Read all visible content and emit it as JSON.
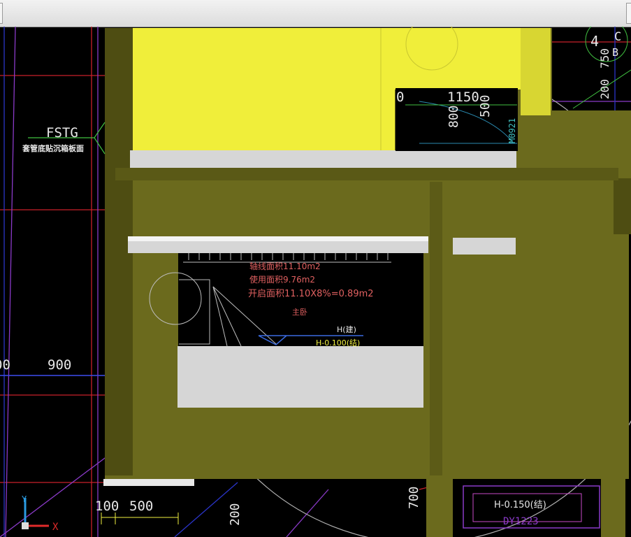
{
  "colors": {
    "background": "#000000",
    "wall": "#6b6a1d",
    "wall_dark": "#4e4d12",
    "yellow_block": "#f0ee3a",
    "slab_gray": "#d6d6d6",
    "grid_red": "#c8202a",
    "grid_blue": "#2a34c8",
    "grid_purple": "#8a3ac8",
    "circle_gray": "#b0b0b0",
    "text_white": "#e8e8e8",
    "text_red": "#e06060",
    "text_yellow": "#f0f040",
    "text_cyan": "#40c0c0"
  },
  "titlebar": {
    "button_icon": "window-button-icon"
  },
  "labels": {
    "fstg": "FSTG",
    "fstg_note": "套管底贴沉箱板面",
    "dim_900_left": "00",
    "dim_900": "900",
    "dim_100": "100",
    "dim_500": "500",
    "dim_200_bottom": "200",
    "dim_700": "700",
    "dim_1150": "1150",
    "dim_0": "0",
    "dim_800": "800",
    "dim_500_v": "500",
    "door_m0921": "M0921",
    "axis_4": "4",
    "axis_c": "C",
    "axis_b": "B",
    "dim_750": "750",
    "dim_200_right": "200",
    "room_area_floor": "轴线面积11.10m2",
    "room_area_use": "使用面积9.76m2",
    "room_area_open": "开启面积11.10X8%=0.89m2",
    "room_name": "主卧",
    "h_label": "H(建)",
    "h_level": "H-0.100(结)",
    "h_level_right": "H-0.150(结)",
    "window_code": "DY1223",
    "ucs_y": "Y",
    "ucs_x": "X"
  }
}
